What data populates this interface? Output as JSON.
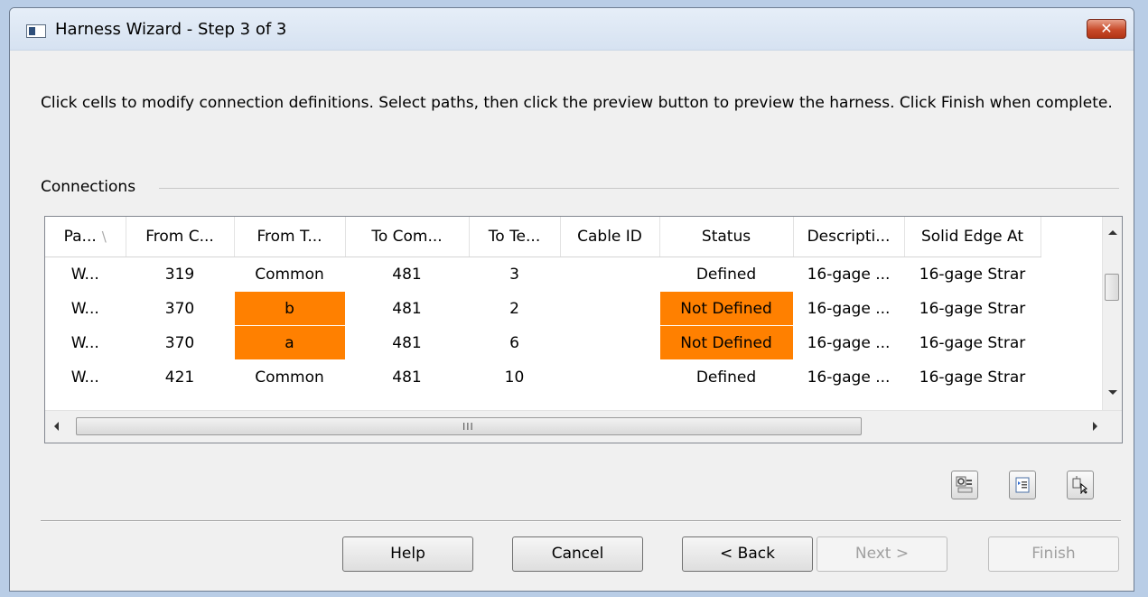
{
  "window": {
    "title": "Harness Wizard - Step 3 of 3",
    "close_glyph": "✕"
  },
  "instructions": "Click cells to modify connection definitions.  Select paths, then click the preview button to preview the harness.  Click Finish when complete.",
  "connections": {
    "label": "Connections",
    "columns": [
      "Pa...",
      "From C...",
      "From T...",
      "To Com...",
      "To Te...",
      "Cable ID",
      "Status",
      "Descripti...",
      "Solid Edge At"
    ],
    "sort_glyph": "\\",
    "rows": [
      {
        "path": "W...",
        "from_comp": "319",
        "from_term": "Common",
        "to_comp": "481",
        "to_term": "3",
        "cable_id": "",
        "status": "Defined",
        "description": "16-gage ...",
        "se_attr": "16-gage Strar",
        "from_term_error": false,
        "status_error": false
      },
      {
        "path": "W...",
        "from_comp": "370",
        "from_term": "b",
        "to_comp": "481",
        "to_term": "2",
        "cable_id": "",
        "status": "Not Defined",
        "description": "16-gage ...",
        "se_attr": "16-gage Strar",
        "from_term_error": true,
        "status_error": true
      },
      {
        "path": "W...",
        "from_comp": "370",
        "from_term": "a",
        "to_comp": "481",
        "to_term": "6",
        "cable_id": "",
        "status": "Not Defined",
        "description": "16-gage ...",
        "se_attr": "16-gage Strar",
        "from_term_error": true,
        "status_error": true
      },
      {
        "path": "W...",
        "from_comp": "421",
        "from_term": "Common",
        "to_comp": "481",
        "to_term": "10",
        "cable_id": "",
        "status": "Defined",
        "description": "16-gage ...",
        "se_attr": "16-gage Strar",
        "from_term_error": false,
        "status_error": false
      }
    ],
    "error_color": "#ff8000",
    "scroll_grip": "III"
  },
  "toolbar": {
    "icons": [
      "find-connections-icon",
      "properties-list-icon",
      "select-path-icon"
    ]
  },
  "buttons": {
    "help": "Help",
    "cancel": "Cancel",
    "back": "< Back",
    "next": "Next >",
    "finish": "Finish"
  }
}
